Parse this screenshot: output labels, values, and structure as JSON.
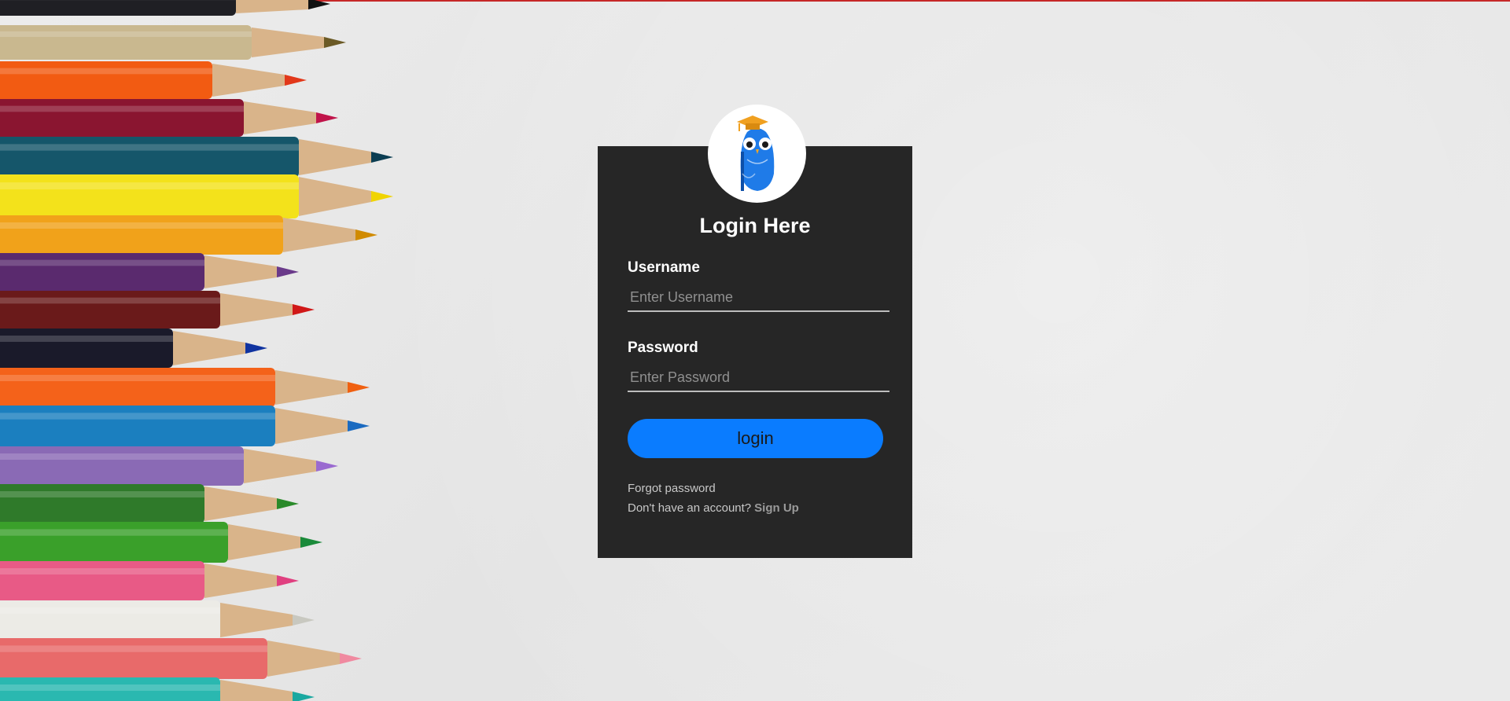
{
  "colors": {
    "card_background": "#262626",
    "button": "#0a7cff",
    "top_accent": "#c62828"
  },
  "images": {
    "background": "colored-pencils-on-paper",
    "logo": "owl-graduation-cap-logo"
  },
  "login": {
    "title": "Login Here",
    "username_label": "Username",
    "username_placeholder": "Enter Username",
    "password_label": "Password",
    "password_placeholder": "Enter Password",
    "button_label": "login",
    "forgot_password": "Forgot password",
    "no_account_text": "Don't have an account?",
    "signup_link": "Sign Up"
  }
}
